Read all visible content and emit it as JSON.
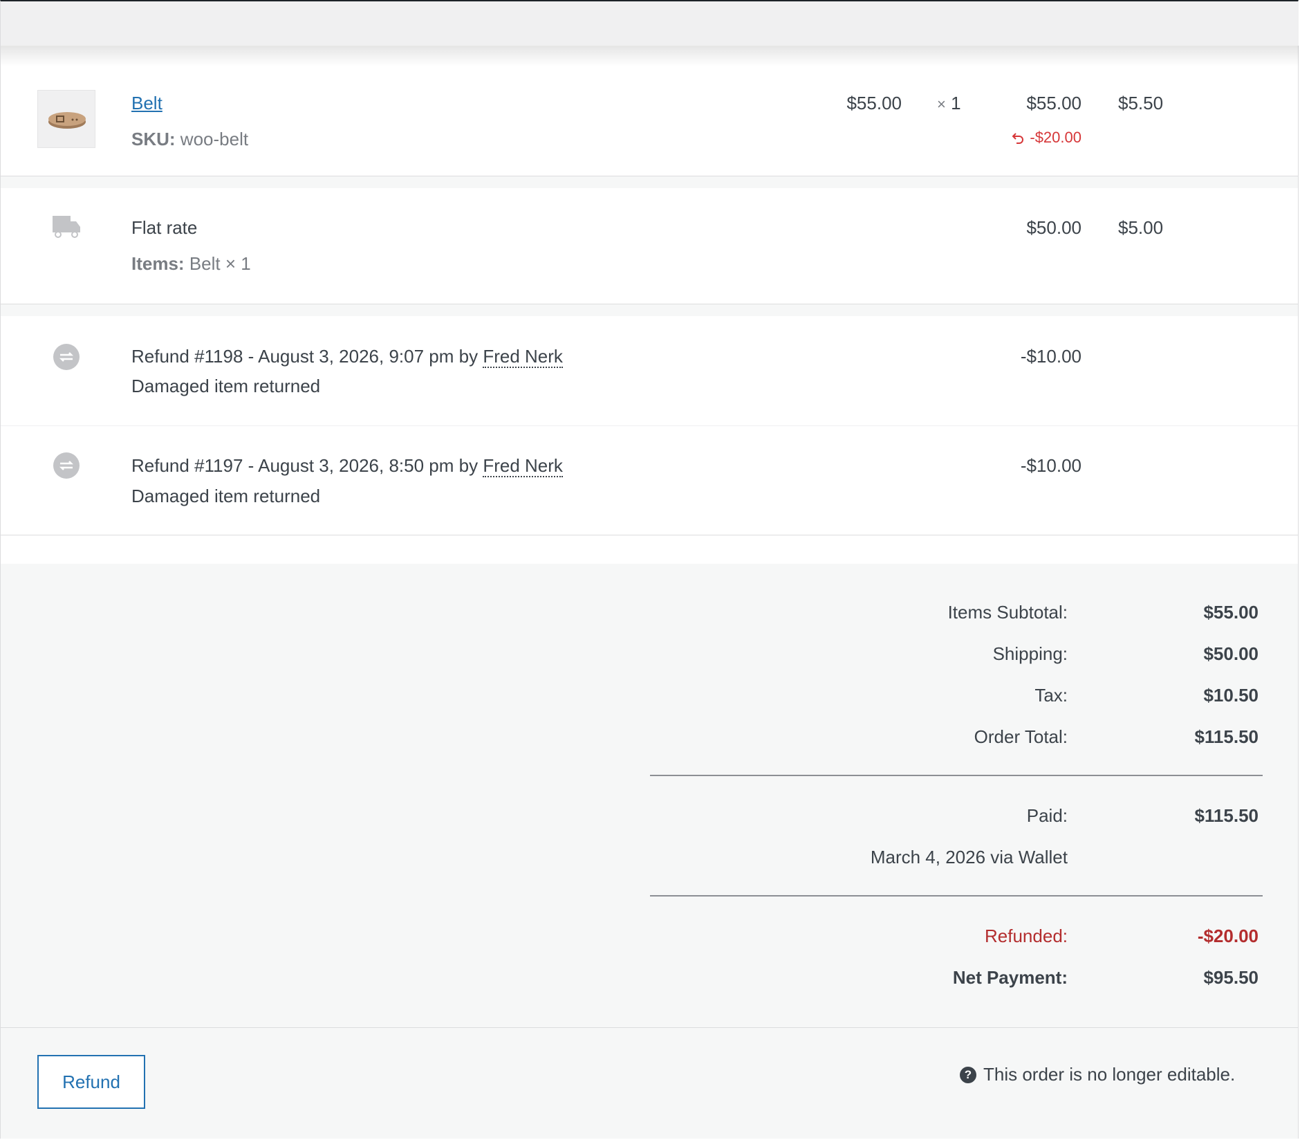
{
  "line_items": [
    {
      "name": "Belt",
      "sku_label": "SKU:",
      "sku_value": "woo-belt",
      "cost": "$55.00",
      "qty": "× 1",
      "total": "$55.00",
      "tax": "$5.50",
      "refunded": "-$20.00",
      "thumbnail_icon": "belt-product-image"
    }
  ],
  "shipping": {
    "method": "Flat rate",
    "items_label": "Items:",
    "items_value": "Belt × 1",
    "total": "$50.00",
    "tax": "$5.00",
    "icon": "truck-icon"
  },
  "refunds": [
    {
      "title": "Refund #1198 - August 3, 2026, 9:07 pm by ",
      "author": "Fred Nerk",
      "reason": "Damaged item returned",
      "amount": "-$10.00",
      "icon": "refund-icon"
    },
    {
      "title": "Refund #1197 - August 3, 2026, 8:50 pm by ",
      "author": "Fred Nerk",
      "reason": "Damaged item returned",
      "amount": "-$10.00",
      "icon": "refund-icon"
    }
  ],
  "totals": {
    "items_subtotal_label": "Items Subtotal:",
    "items_subtotal": "$55.00",
    "shipping_label": "Shipping:",
    "shipping": "$50.00",
    "tax_label": "Tax:",
    "tax": "$10.50",
    "order_total_label": "Order Total:",
    "order_total": "$115.50",
    "paid_label": "Paid:",
    "paid": "$115.50",
    "paid_note": "March 4, 2026 via Wallet",
    "refunded_label": "Refunded:",
    "refunded": "-$20.00",
    "net_payment_label": "Net Payment:",
    "net_payment": "$95.50"
  },
  "footer": {
    "refund_button": "Refund",
    "help_icon": "question-circle-icon",
    "help_icon_glyph": "?",
    "notice": "This order is no longer editable."
  },
  "colors": {
    "link": "#2271b1",
    "refund_red": "#d63638",
    "refunded_total_red": "#b32d2e",
    "panel_bg": "#f6f7f7"
  }
}
